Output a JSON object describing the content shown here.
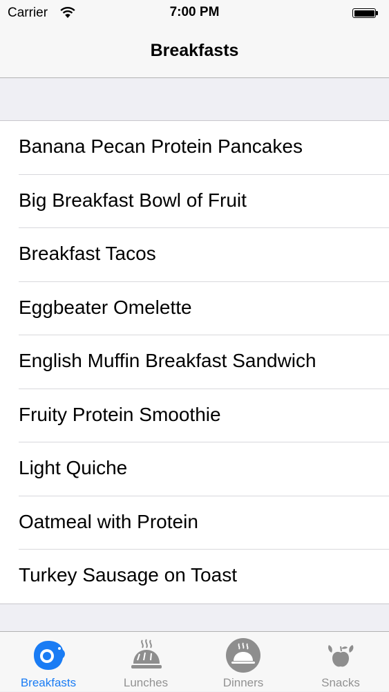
{
  "status_bar": {
    "carrier": "Carrier",
    "time": "7:00 PM"
  },
  "nav": {
    "title": "Breakfasts"
  },
  "items": [
    "Banana Pecan Protein Pancakes",
    "Big Breakfast Bowl of Fruit",
    "Breakfast Tacos",
    "Eggbeater Omelette",
    "English Muffin Breakfast Sandwich",
    "Fruity Protein Smoothie",
    "Light Quiche",
    "Oatmeal with Protein",
    "Turkey Sausage on Toast"
  ],
  "tabs": [
    {
      "label": "Breakfasts",
      "icon": "egg-icon",
      "active": true
    },
    {
      "label": "Lunches",
      "icon": "bread-icon",
      "active": false
    },
    {
      "label": "Dinners",
      "icon": "cloche-icon",
      "active": false
    },
    {
      "label": "Snacks",
      "icon": "fruit-icon",
      "active": false
    }
  ],
  "colors": {
    "accent": "#1a7cf4",
    "inactive": "#929292",
    "background": "#efeff4"
  }
}
